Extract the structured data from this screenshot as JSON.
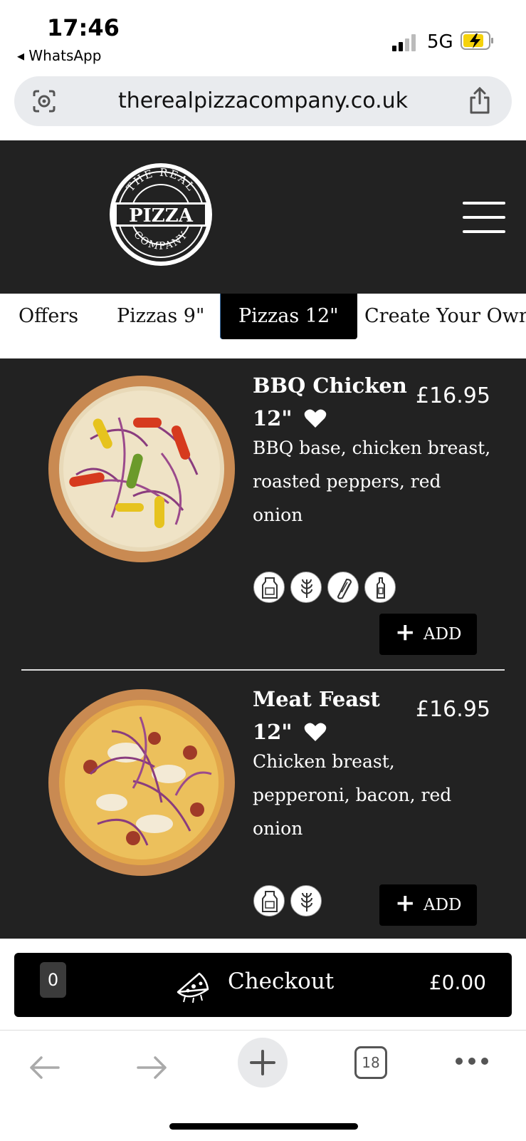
{
  "status_bar": {
    "time": "17:46",
    "back_app": "◂ WhatsApp",
    "network": "5G"
  },
  "url_bar": {
    "url": "therealpizzacompany.co.uk"
  },
  "header": {
    "logo_text": [
      "THE REAL",
      "PIZZA",
      "COMPANY"
    ]
  },
  "tabs": [
    {
      "label": "Offers"
    },
    {
      "label": "Pizzas 9\""
    },
    {
      "label": "Pizzas 12\"",
      "active": true
    },
    {
      "label": "Create Your Own"
    }
  ],
  "menu": {
    "items": [
      {
        "title_line1": "BBQ Chicken",
        "title_line2": "12\"",
        "price": "£16.95",
        "description": [
          "BBQ base, chicken breast,",
          "roasted peppers, red",
          "onion"
        ],
        "allergens": [
          "milk-icon",
          "wheat-icon",
          "celery-icon",
          "mustard-icon"
        ],
        "add_label": "ADD"
      },
      {
        "title_line1": "Meat Feast",
        "title_line2": "12\"",
        "price": "£16.95",
        "description": [
          "Chicken breast,",
          "pepperoni, bacon, red",
          "onion"
        ],
        "allergens": [
          "milk-icon",
          "wheat-icon"
        ],
        "add_label": "ADD"
      }
    ]
  },
  "checkout": {
    "count": "0",
    "label": "Checkout",
    "total": "£0.00"
  },
  "browser": {
    "tab_count": "18"
  },
  "colors": {
    "dark_bg": "#222222",
    "black": "#000000",
    "accent_battery": "#f5d20c"
  }
}
